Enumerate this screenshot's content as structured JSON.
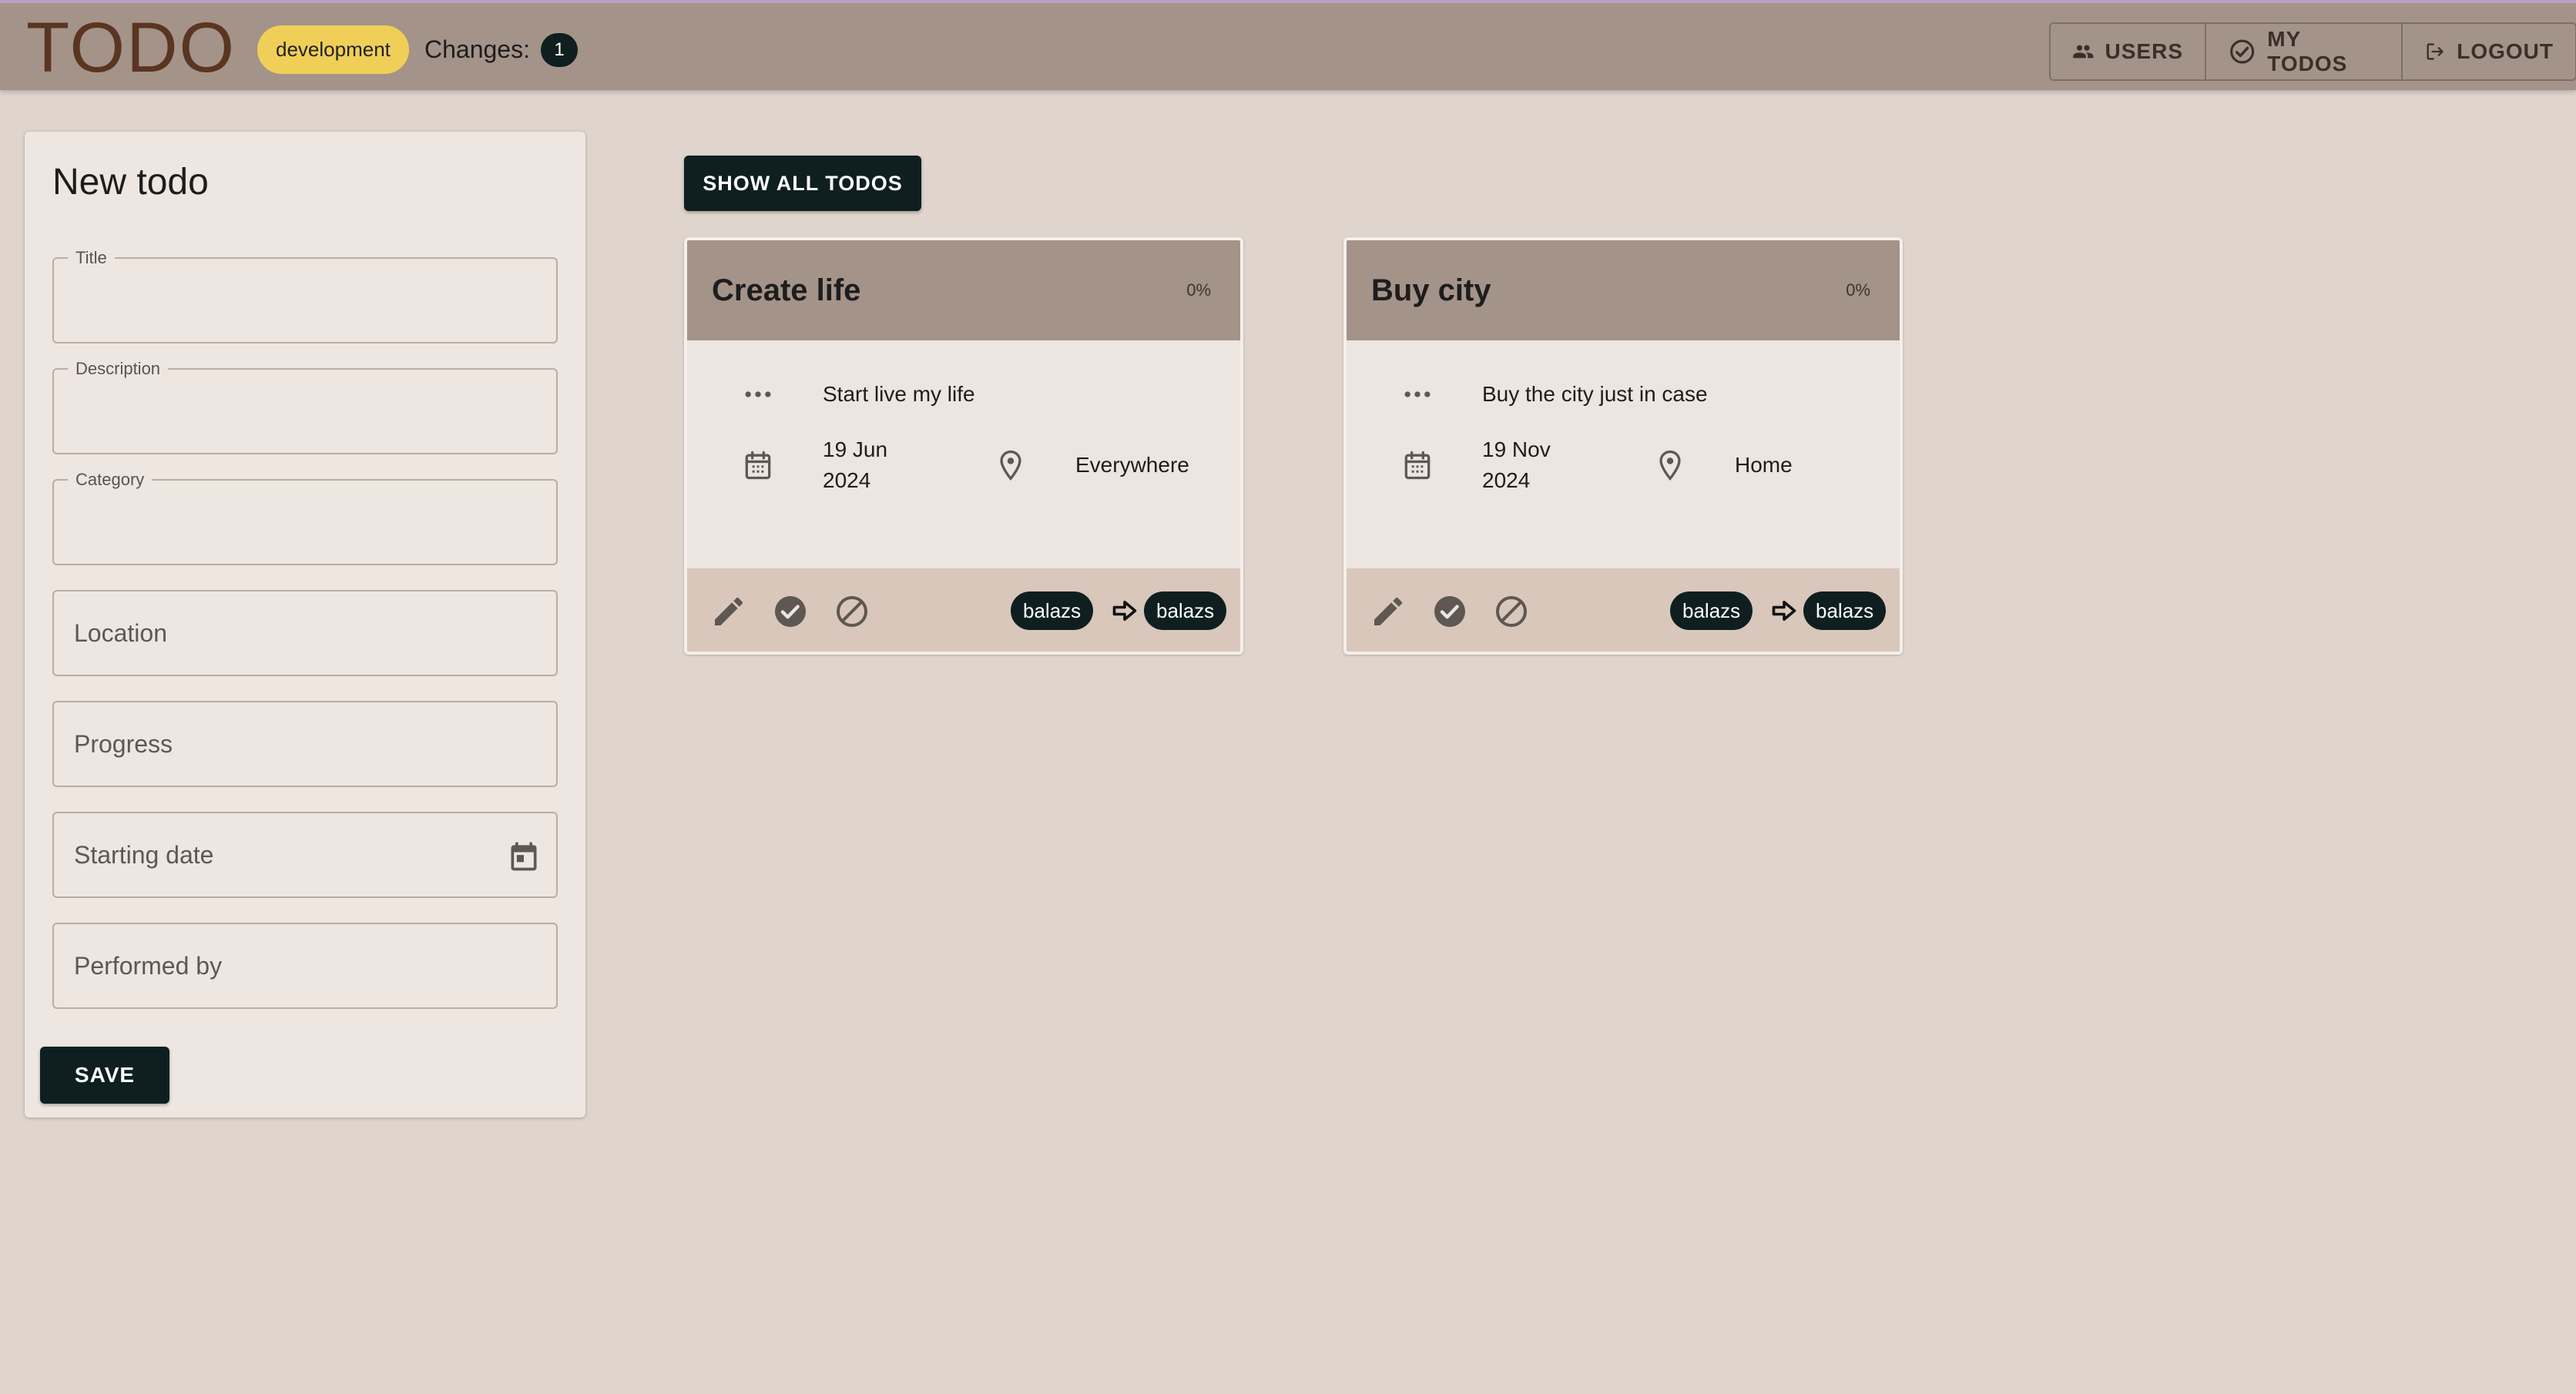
{
  "header": {
    "app_title": "TODO",
    "environment": "development",
    "changes_label": "Changes:",
    "changes_count": "1",
    "nav": {
      "users": "USERS",
      "my_todos": "MY TODOS",
      "logout": "LOGOUT"
    }
  },
  "form": {
    "title": "New todo",
    "fields": {
      "title": {
        "label": "Title",
        "value": ""
      },
      "description": {
        "label": "Description",
        "value": ""
      },
      "category": {
        "label": "Category",
        "value": ""
      },
      "location": {
        "placeholder": "Location"
      },
      "progress": {
        "placeholder": "Progress"
      },
      "starting_date": {
        "placeholder": "Starting date",
        "icon": "calendar-icon"
      },
      "performed_by": {
        "placeholder": "Performed by"
      }
    },
    "save_label": "SAVE"
  },
  "main": {
    "show_all_label": "SHOW ALL TODOS",
    "todos": [
      {
        "title": "Create life",
        "progress": "0%",
        "description": "Start live my life",
        "date_line1": "19 Jun",
        "date_line2": "2024",
        "location": "Everywhere",
        "created_by": "balazs",
        "performed_by": "balazs"
      },
      {
        "title": "Buy city",
        "progress": "0%",
        "description": "Buy the city just in case",
        "date_line1": "19 Nov",
        "date_line2": "2024",
        "location": "Home",
        "created_by": "balazs",
        "performed_by": "balazs"
      }
    ]
  },
  "colors": {
    "appbar": "#a49388",
    "background": "#e0d5cc",
    "title_brown": "#5a3521",
    "env_chip": "#f0cf59",
    "dark_button": "#0f1f1f",
    "card_footer": "#d9c7bc"
  }
}
